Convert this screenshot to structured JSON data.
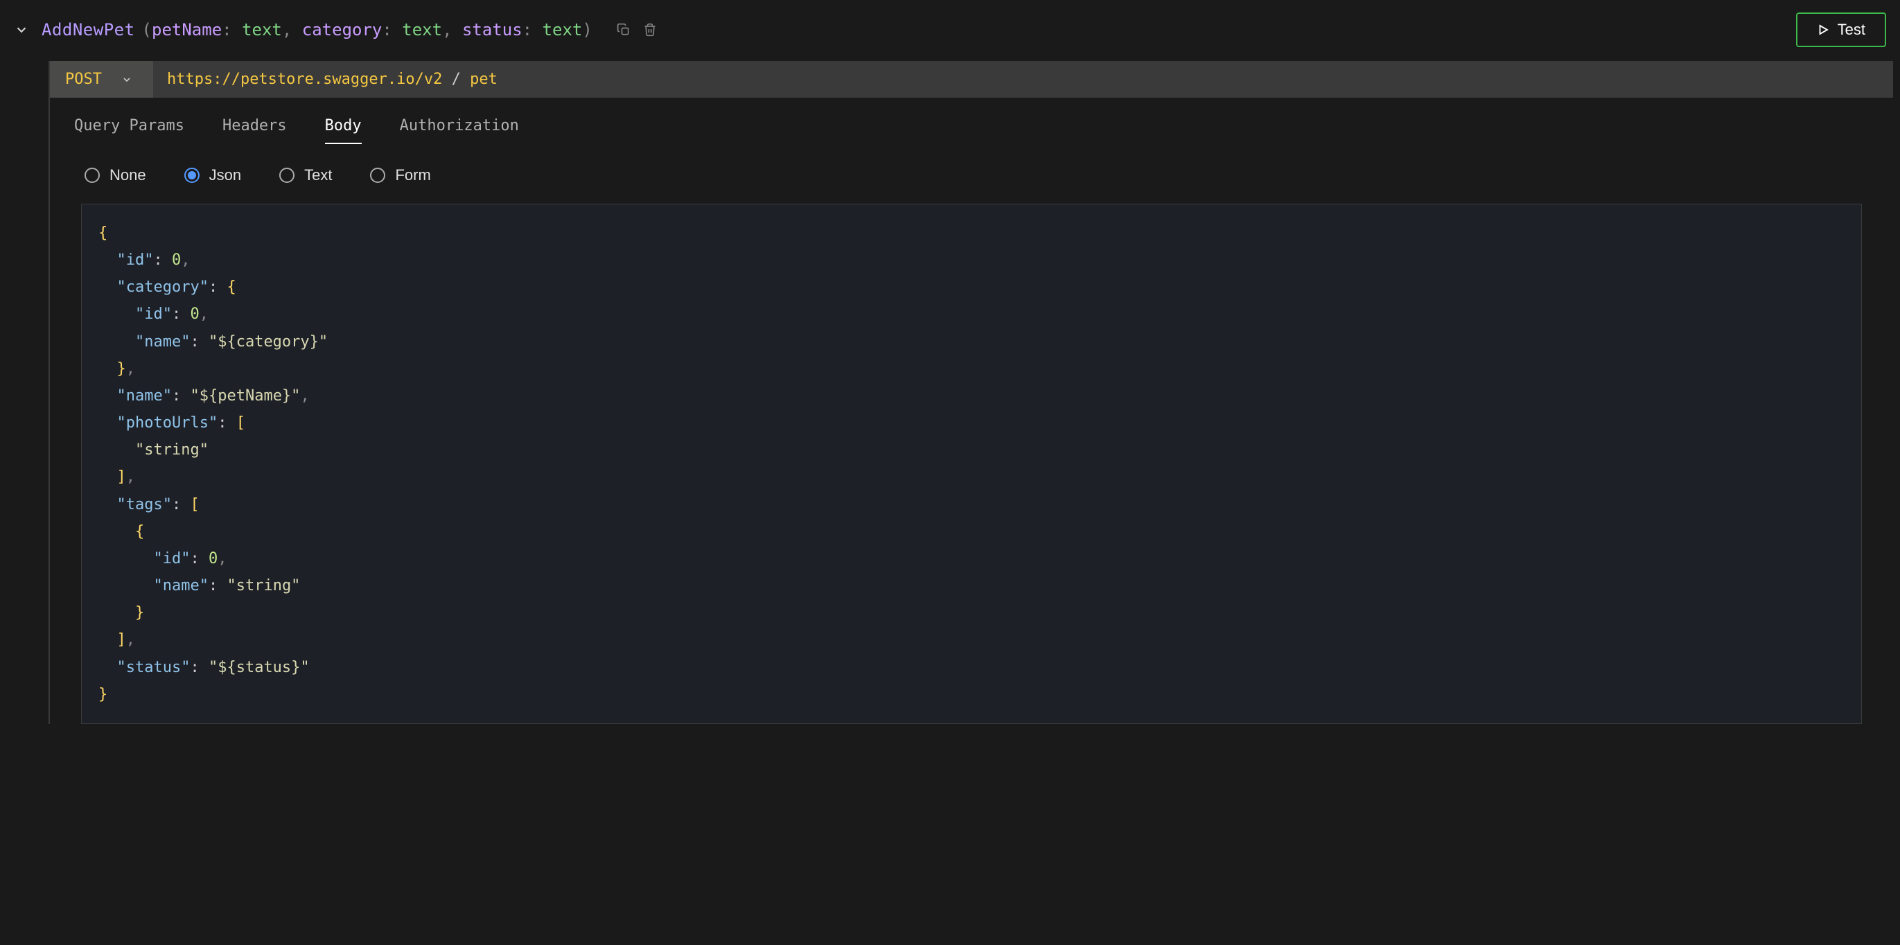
{
  "header": {
    "api_name": "AddNewPet",
    "params": [
      {
        "name": "petName",
        "type": "text"
      },
      {
        "name": "category",
        "type": "text"
      },
      {
        "name": "status",
        "type": "text"
      }
    ],
    "test_button": "Test"
  },
  "request": {
    "method": "POST",
    "url_base": "https://petstore.swagger.io/v2",
    "url_sep": " / ",
    "url_path": "pet"
  },
  "tabs": {
    "query_params": "Query Params",
    "headers": "Headers",
    "body": "Body",
    "authorization": "Authorization",
    "active": "body"
  },
  "body_types": {
    "none": "None",
    "json": "Json",
    "text": "Text",
    "form": "Form",
    "selected": "json"
  },
  "json_body_lines": [
    [
      {
        "t": "brace",
        "v": "{"
      }
    ],
    [
      {
        "t": "ind",
        "v": "  "
      },
      {
        "t": "key",
        "v": "\"id\""
      },
      {
        "t": "colon",
        "v": ": "
      },
      {
        "t": "num",
        "v": "0"
      },
      {
        "t": "comma",
        "v": ","
      }
    ],
    [
      {
        "t": "ind",
        "v": "  "
      },
      {
        "t": "key",
        "v": "\"category\""
      },
      {
        "t": "colon",
        "v": ": "
      },
      {
        "t": "brace",
        "v": "{"
      }
    ],
    [
      {
        "t": "ind",
        "v": "    "
      },
      {
        "t": "key",
        "v": "\"id\""
      },
      {
        "t": "colon",
        "v": ": "
      },
      {
        "t": "num",
        "v": "0"
      },
      {
        "t": "comma",
        "v": ","
      }
    ],
    [
      {
        "t": "ind",
        "v": "    "
      },
      {
        "t": "key",
        "v": "\"name\""
      },
      {
        "t": "colon",
        "v": ": "
      },
      {
        "t": "str",
        "v": "\"${category}\""
      }
    ],
    [
      {
        "t": "ind",
        "v": "  "
      },
      {
        "t": "brace",
        "v": "}"
      },
      {
        "t": "comma",
        "v": ","
      }
    ],
    [
      {
        "t": "ind",
        "v": "  "
      },
      {
        "t": "key",
        "v": "\"name\""
      },
      {
        "t": "colon",
        "v": ": "
      },
      {
        "t": "str",
        "v": "\"${petName}\""
      },
      {
        "t": "comma",
        "v": ","
      }
    ],
    [
      {
        "t": "ind",
        "v": "  "
      },
      {
        "t": "key",
        "v": "\"photoUrls\""
      },
      {
        "t": "colon",
        "v": ": "
      },
      {
        "t": "bracket",
        "v": "["
      }
    ],
    [
      {
        "t": "ind",
        "v": "    "
      },
      {
        "t": "str",
        "v": "\"string\""
      }
    ],
    [
      {
        "t": "ind",
        "v": "  "
      },
      {
        "t": "bracket",
        "v": "]"
      },
      {
        "t": "comma",
        "v": ","
      }
    ],
    [
      {
        "t": "ind",
        "v": "  "
      },
      {
        "t": "key",
        "v": "\"tags\""
      },
      {
        "t": "colon",
        "v": ": "
      },
      {
        "t": "bracket",
        "v": "["
      }
    ],
    [
      {
        "t": "ind",
        "v": "    "
      },
      {
        "t": "brace",
        "v": "{"
      }
    ],
    [
      {
        "t": "ind",
        "v": "      "
      },
      {
        "t": "key",
        "v": "\"id\""
      },
      {
        "t": "colon",
        "v": ": "
      },
      {
        "t": "num",
        "v": "0"
      },
      {
        "t": "comma",
        "v": ","
      }
    ],
    [
      {
        "t": "ind",
        "v": "      "
      },
      {
        "t": "key",
        "v": "\"name\""
      },
      {
        "t": "colon",
        "v": ": "
      },
      {
        "t": "str",
        "v": "\"string\""
      }
    ],
    [
      {
        "t": "ind",
        "v": "    "
      },
      {
        "t": "brace",
        "v": "}"
      }
    ],
    [
      {
        "t": "ind",
        "v": "  "
      },
      {
        "t": "bracket",
        "v": "]"
      },
      {
        "t": "comma",
        "v": ","
      }
    ],
    [
      {
        "t": "ind",
        "v": "  "
      },
      {
        "t": "key",
        "v": "\"status\""
      },
      {
        "t": "colon",
        "v": ": "
      },
      {
        "t": "str",
        "v": "\"${status}\""
      }
    ],
    [
      {
        "t": "brace",
        "v": "}"
      }
    ]
  ]
}
